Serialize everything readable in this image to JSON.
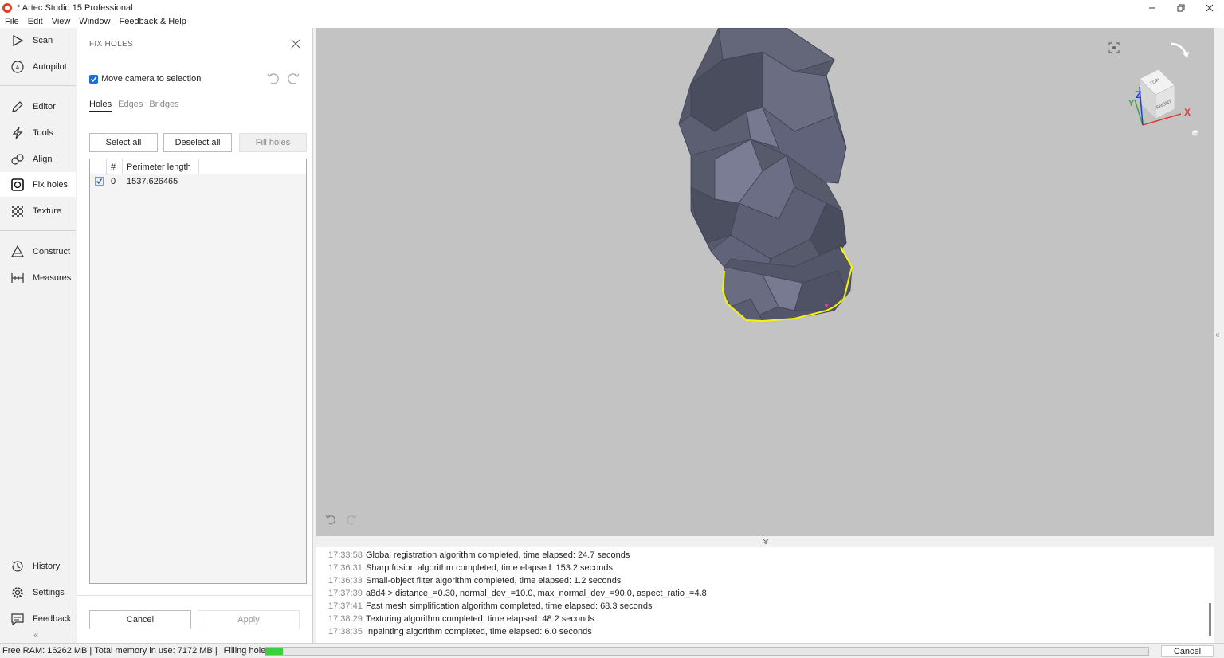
{
  "window": {
    "title": "* Artec Studio 15 Professional",
    "controls": [
      "minimize-icon",
      "restore-icon",
      "close-icon"
    ]
  },
  "menu": [
    "File",
    "Edit",
    "View",
    "Window",
    "Feedback & Help"
  ],
  "nav": {
    "items": [
      {
        "label": "Scan",
        "icon": "play-icon"
      },
      {
        "label": "Autopilot",
        "icon": "autopilot-icon"
      },
      {
        "label": "Editor",
        "icon": "pencil-icon"
      },
      {
        "label": "Tools",
        "icon": "lightning-icon"
      },
      {
        "label": "Align",
        "icon": "align-icon"
      },
      {
        "label": "Fix holes",
        "icon": "fix-holes-icon",
        "active": true
      },
      {
        "label": "Texture",
        "icon": "checker-icon"
      },
      {
        "label": "Construct",
        "icon": "triangle-icon"
      },
      {
        "label": "Measures",
        "icon": "ruler-icon"
      },
      {
        "label": "History",
        "icon": "history-icon"
      },
      {
        "label": "Settings",
        "icon": "gear-icon"
      },
      {
        "label": "Feedback",
        "icon": "feedback-icon"
      }
    ],
    "collapse": "«"
  },
  "panel": {
    "title": "FIX HOLES",
    "move_camera_label": "Move camera to selection",
    "move_camera_checked": true,
    "tabs": [
      {
        "label": "Holes",
        "active": true
      },
      {
        "label": "Edges",
        "active": false
      },
      {
        "label": "Bridges",
        "active": false
      }
    ],
    "select_all": "Select all",
    "deselect_all": "Deselect all",
    "fill_holes": "Fill holes",
    "table": {
      "headers": [
        "#",
        "Perimeter length"
      ],
      "rows": [
        {
          "checked": true,
          "index": "0",
          "perimeter": "1537.626465"
        }
      ]
    },
    "cancel": "Cancel",
    "apply": "Apply"
  },
  "log": [
    {
      "time": "17:33:58",
      "text": "Global registration algorithm completed, time elapsed: 24.7 seconds"
    },
    {
      "time": "17:36:31",
      "text": "Sharp fusion algorithm completed, time elapsed: 153.2 seconds"
    },
    {
      "time": "17:36:33",
      "text": "Small-object filter algorithm completed, time elapsed: 1.2 seconds"
    },
    {
      "time": "17:37:39",
      "text": "a8d4 > distance_=0.30, normal_dev_=10.0, max_normal_dev_=90.0, aspect_ratio_=4.8"
    },
    {
      "time": "17:37:41",
      "text": "Fast mesh simplification algorithm completed, time elapsed: 68.3 seconds"
    },
    {
      "time": "17:38:29",
      "text": "Texturing algorithm completed, time elapsed: 48.2 seconds"
    },
    {
      "time": "17:38:35",
      "text": "Inpainting algorithm completed, time elapsed: 6.0 seconds"
    }
  ],
  "view_cube": {
    "top": "TOP",
    "front": "FRONT",
    "x": "X",
    "y": "Y",
    "z": "Z"
  },
  "status": {
    "free_ram": "Free RAM: 16262 MB",
    "sep1": "|",
    "total_memory": "Total memory in use: 7172 MB",
    "sep2": "|",
    "operation": "Filling holes",
    "progress": 0.02,
    "cancel": "Cancel"
  },
  "colors": {
    "accent": "#1a6fd6",
    "viewport_bg": "#c3c3c3",
    "mesh": "#5a5d72",
    "hole_outline": "#f5f500",
    "progress": "#3ccf3c"
  }
}
